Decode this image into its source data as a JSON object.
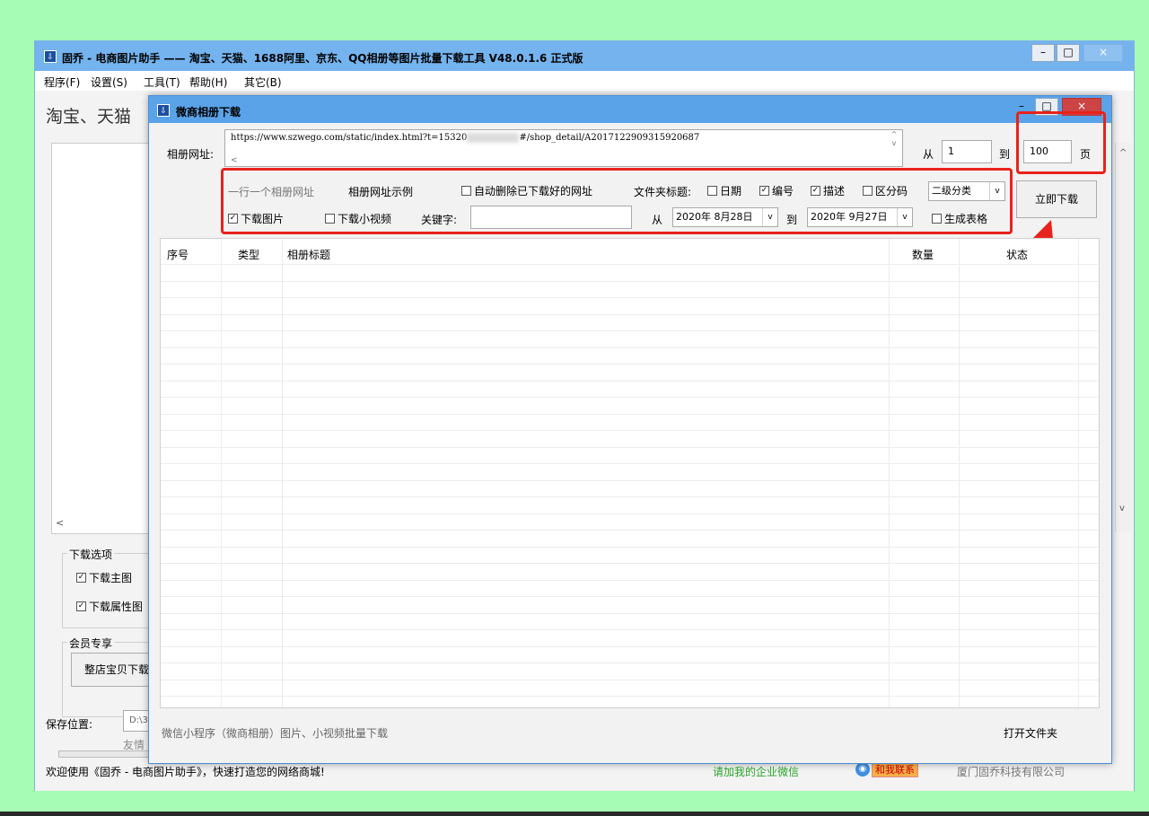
{
  "main_window": {
    "title": "固乔 - 电商图片助手 —— 淘宝、天猫、1688阿里、京东、QQ相册等图片批量下载工具 V48.0.1.6 正式版",
    "controls": {
      "minimize": "–",
      "maximize": "□",
      "close": "×"
    },
    "menu": [
      "程序(F)",
      "设置(S)",
      "工具(T)",
      "帮助(H)",
      "其它(B)"
    ],
    "left_heading": "淘宝、天猫",
    "download_options_label": "下载选项",
    "download_main_image": "下载主图",
    "download_attr_image": "下载属性图",
    "member_label": "会员专享",
    "whole_shop_button": "整店宝贝下载",
    "save_location_label": "保存位置:",
    "save_location_value": "D:\\3",
    "friend_text": "友情",
    "scroll_left": "<",
    "scroll_down": "v",
    "scroll_up": "^"
  },
  "dialog": {
    "title": "微商相册下载",
    "url_label": "相册网址:",
    "url_value_part1": "https://www.szwego.com/static/index.html?t=15320",
    "url_value_part2": "#/shop_detail/A2017122909315920687",
    "from_label": "从",
    "page_from": "1",
    "to_label": "到",
    "page_to": "100",
    "page_unit": "页",
    "one_per_line": "一行一个相册网址",
    "url_example": "相册网址示例",
    "auto_delete": "自动删除已下载好的网址",
    "folder_title_label": "文件夹标题:",
    "date_option": "日期",
    "number_option": "编号",
    "desc_option": "描述",
    "zone_option": "区分码",
    "category_select": "二级分类",
    "download_now": "立即下载",
    "download_images": "下载图片",
    "download_videos": "下载小视频",
    "keyword_label": "关键字:",
    "date_from_label": "从",
    "date_from": "2020年 8月28日",
    "date_to_label": "到",
    "date_to": "2020年 9月27日",
    "generate_table": "生成表格",
    "columns": [
      "序号",
      "类型",
      "相册标题",
      "数量",
      "状态"
    ],
    "footer_text": "微信小程序（微商相册）图片、小视频批量下载",
    "open_folder": "打开文件夹"
  },
  "status_bar": {
    "welcome": "欢迎使用《固乔 - 电商图片助手》，快速打造您的网络商城!",
    "wechat": "请加我的企业微信",
    "contact": "和我联系",
    "company": "厦门固乔科技有限公司"
  },
  "colors": {
    "background": "#a6fcb4",
    "highlight_red": "#e8221c",
    "wechat_green": "#2aa52a"
  }
}
